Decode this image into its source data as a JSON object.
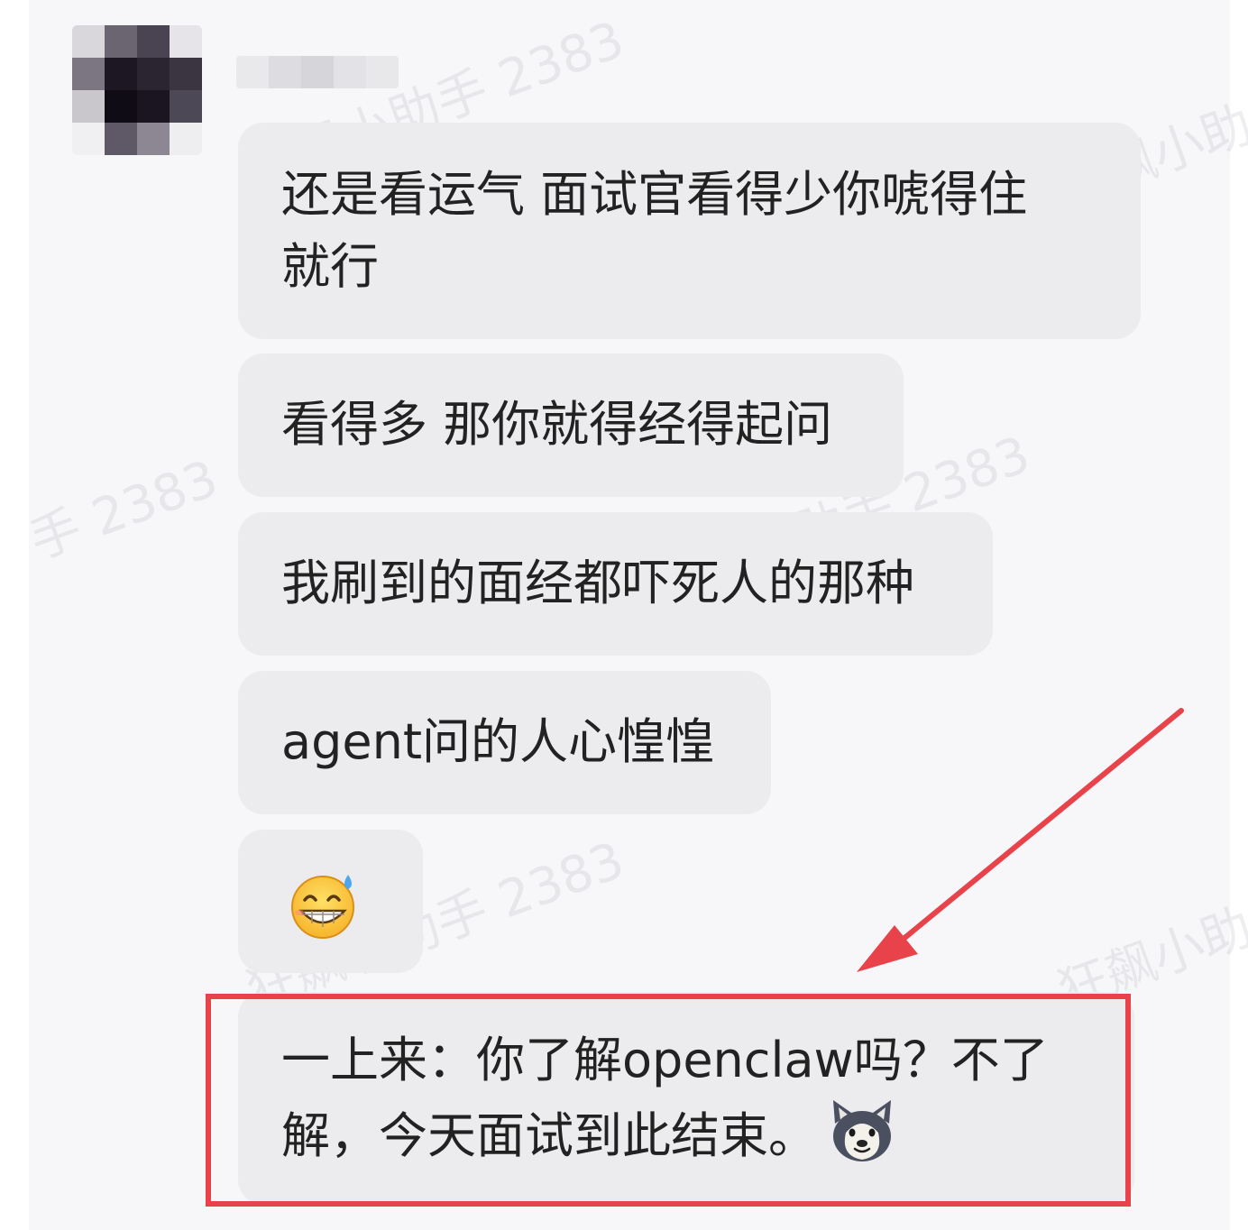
{
  "messages": [
    {
      "text": "还是看运气 面试官看得少你唬得住\n就行"
    },
    {
      "text": "看得多 那你就得经得起问"
    },
    {
      "text": "我刷到的面经都吓死人的那种"
    },
    {
      "text": "agent问的人心惶惶"
    },
    {
      "emoji": "grinning-sweat-emoji"
    },
    {
      "text": "一上来：你了解openclaw吗？不了\n解，今天面试到此结束。",
      "trailing_emoji": "husky-dog-emoji",
      "highlighted": true
    }
  ],
  "watermark": {
    "text": "狂飙小助手 2383",
    "partial_left": "手 2383",
    "partial_right": "狂飙小助"
  },
  "colors": {
    "bubble": "#ececef",
    "highlight": "#e8434a",
    "background": "#f7f7f9"
  }
}
